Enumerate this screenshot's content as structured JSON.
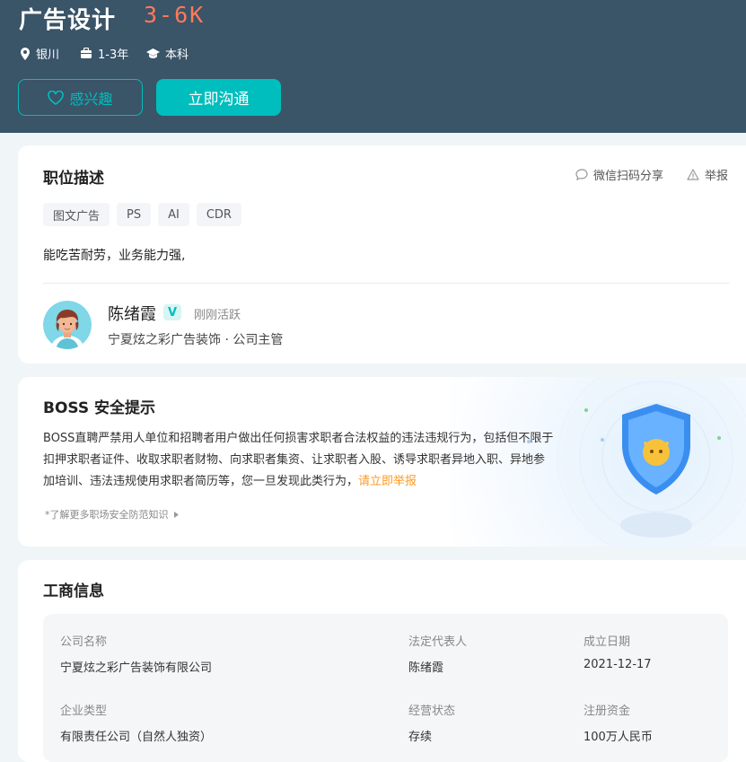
{
  "job": {
    "title": "广告设计",
    "salary": "3-6K",
    "city": "银川",
    "experience": "1-3年",
    "degree": "本科",
    "interest_label": "感兴趣",
    "chat_label": "立即沟通"
  },
  "description": {
    "title": "职位描述",
    "share_label": "微信扫码分享",
    "report_label": "举报",
    "tags": [
      "图文广告",
      "PS",
      "AI",
      "CDR"
    ],
    "text": "能吃苦耐劳，业务能力强,"
  },
  "boss": {
    "name": "陈绪霞",
    "badge": "V",
    "status": "刚刚活跃",
    "company_title": "宁夏炫之彩广告装饰 ·  公司主管"
  },
  "safety": {
    "title": "BOSS 安全提示",
    "text": "BOSS直聘严禁用人单位和招聘者用户做出任何损害求职者合法权益的违法违规行为，包括但不限于扣押求职者证件、收取求职者财物、向求职者集资、让求职者入股、诱导求职者异地入职、异地参加培训、违法违规使用求职者简历等，您一旦发现此类行为，",
    "link": "请立即举报",
    "more": "*了解更多职场安全防范知识"
  },
  "business": {
    "title": "工商信息",
    "fields": [
      {
        "label": "公司名称",
        "value": "宁夏炫之彩广告装饰有限公司"
      },
      {
        "label": "法定代表人",
        "value": "陈绪霞"
      },
      {
        "label": "成立日期",
        "value": "2021-12-17"
      },
      {
        "label": "企业类型",
        "value": "有限责任公司（自然人独资）"
      },
      {
        "label": "经营状态",
        "value": "存续"
      },
      {
        "label": "注册资金",
        "value": "100万人民币"
      }
    ]
  },
  "colors": {
    "header_bg": "#3a5468",
    "accent": "#00bebd",
    "salary": "#ff7a5a",
    "link": "#ff9a1f"
  }
}
